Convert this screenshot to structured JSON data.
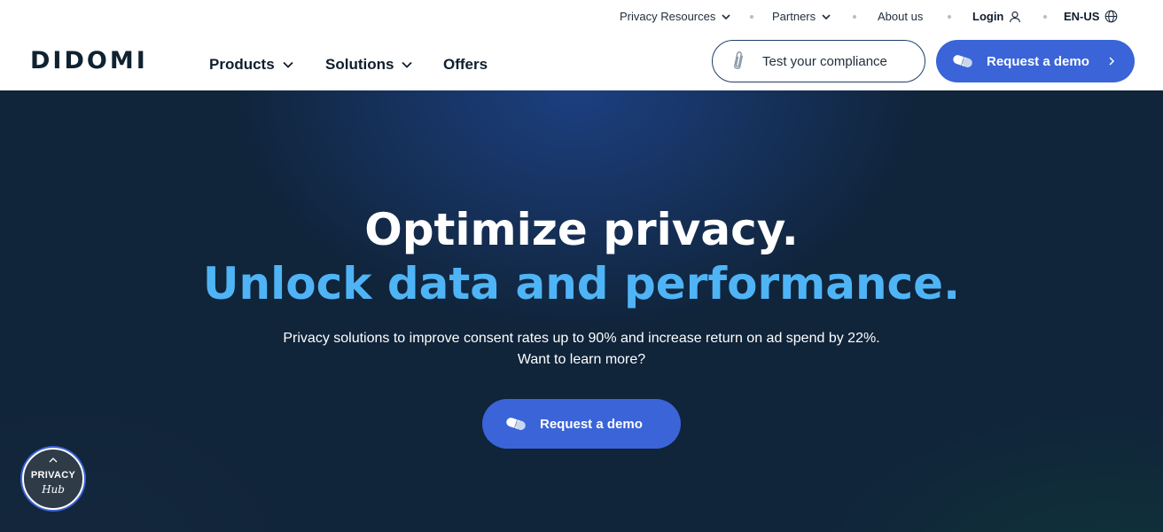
{
  "utility_nav": {
    "privacy_resources": "Privacy Resources",
    "partners": "Partners",
    "about_us": "About us",
    "login": "Login",
    "language": "EN-US"
  },
  "header": {
    "logo": "DIDOMI",
    "nav": {
      "products": "Products",
      "solutions": "Solutions",
      "offers": "Offers"
    },
    "test_compliance": "Test your compliance",
    "request_demo": "Request a demo"
  },
  "hero": {
    "title_line1": "Optimize privacy.",
    "title_line2": "Unlock data and performance.",
    "subtitle_line1": "Privacy solutions to improve consent rates up to 90% and increase return on ad spend by 22%.",
    "subtitle_line2": "Want to learn more?",
    "cta": "Request a demo"
  },
  "privacy_hub": {
    "line1": "PRIVACY",
    "line2": "Hub"
  },
  "colors": {
    "primary_button": "#3a64d8",
    "accent_title": "#4fb4f5",
    "hero_background": "#10243a"
  },
  "icons": {
    "dropdown": "chevron-down-icon",
    "login": "user-icon",
    "language": "globe-icon",
    "compliance": "paperclip-icon",
    "demo": "pill-icon",
    "next": "chevron-right-icon",
    "hub_toggle": "chevron-up-icon"
  }
}
